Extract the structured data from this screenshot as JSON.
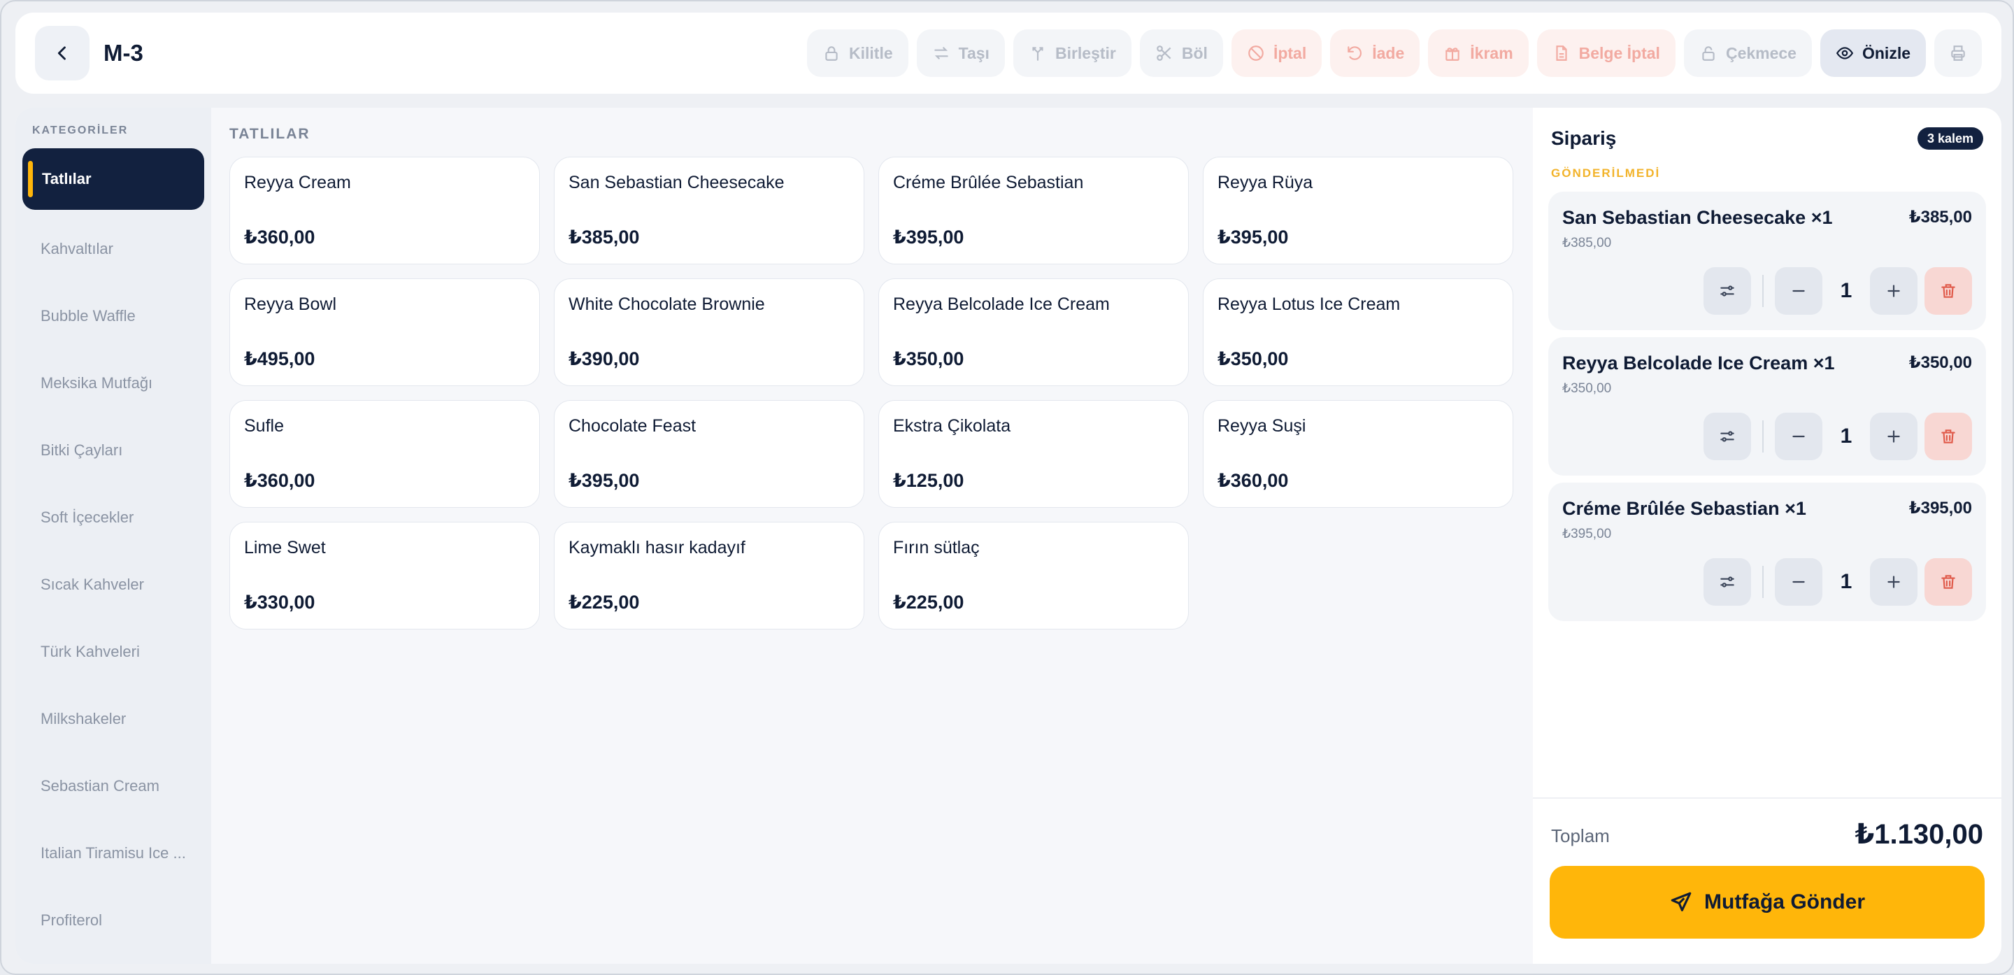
{
  "header": {
    "title": "M-3",
    "actions": [
      {
        "label": "Kilitle",
        "icon": "lock-icon"
      },
      {
        "label": "Taşı",
        "icon": "swap-icon"
      },
      {
        "label": "Birleştir",
        "icon": "merge-icon"
      },
      {
        "label": "Böl",
        "icon": "scissors-icon"
      },
      {
        "label": "İptal",
        "icon": "ban-icon"
      },
      {
        "label": "İade",
        "icon": "undo-icon"
      },
      {
        "label": "İkram",
        "icon": "gift-icon"
      },
      {
        "label": "Belge İptal",
        "icon": "document-icon"
      },
      {
        "label": "Çekmece",
        "icon": "lock-open-icon"
      },
      {
        "label": "Önizle",
        "icon": "eye-icon"
      }
    ]
  },
  "sidebar": {
    "heading": "KATEGORİLER",
    "items": [
      {
        "label": "Tatlılar"
      },
      {
        "label": "Kahvaltılar"
      },
      {
        "label": "Bubble Waffle"
      },
      {
        "label": "Meksika Mutfağı"
      },
      {
        "label": "Bitki Çayları"
      },
      {
        "label": "Soft İçecekler"
      },
      {
        "label": "Sıcak Kahveler"
      },
      {
        "label": "Türk Kahveleri"
      },
      {
        "label": "Milkshakeler"
      },
      {
        "label": "Sebastian Cream"
      },
      {
        "label": "Italian Tiramisu Ice ..."
      },
      {
        "label": "Profiterol"
      }
    ]
  },
  "menu": {
    "heading": "TATLILAR",
    "products": [
      {
        "name": "Reyya Cream",
        "price": "₺360,00"
      },
      {
        "name": "San Sebastian Cheesecake",
        "price": "₺385,00"
      },
      {
        "name": "Créme Brûlée Sebastian",
        "price": "₺395,00"
      },
      {
        "name": "Reyya Rüya",
        "price": "₺395,00"
      },
      {
        "name": "Reyya Bowl",
        "price": "₺495,00"
      },
      {
        "name": "White Chocolate Brownie",
        "price": "₺390,00"
      },
      {
        "name": "Reyya Belcolade Ice Cream",
        "price": "₺350,00"
      },
      {
        "name": "Reyya Lotus Ice Cream",
        "price": "₺350,00"
      },
      {
        "name": "Sufle",
        "price": "₺360,00"
      },
      {
        "name": "Chocolate Feast",
        "price": "₺395,00"
      },
      {
        "name": "Ekstra Çikolata",
        "price": "₺125,00"
      },
      {
        "name": "Reyya Suşi",
        "price": "₺360,00"
      },
      {
        "name": "Lime Swet",
        "price": "₺330,00"
      },
      {
        "name": "Kaymaklı hasır kadayıf",
        "price": "₺225,00"
      },
      {
        "name": "Fırın sütlaç",
        "price": "₺225,00"
      }
    ]
  },
  "order": {
    "title": "Sipariş",
    "badge": "3 kalem",
    "status": "GÖNDERİLMEDİ",
    "items": [
      {
        "name": "San Sebastian Cheesecake",
        "mult": "×1",
        "unit": "₺385,00",
        "total": "₺385,00",
        "qty": "1"
      },
      {
        "name": "Reyya Belcolade Ice Cream",
        "mult": "×1",
        "unit": "₺350,00",
        "total": "₺350,00",
        "qty": "1"
      },
      {
        "name": "Créme Brûlée Sebastian",
        "mult": "×1",
        "unit": "₺395,00",
        "total": "₺395,00",
        "qty": "1"
      }
    ],
    "total_label": "Toplam",
    "total_value": "₺1.130,00",
    "send_label": "Mutfağa Gönder"
  },
  "colors": {
    "accent": "#ffb60a",
    "navy": "#12213f",
    "danger": "#e05a4a"
  }
}
